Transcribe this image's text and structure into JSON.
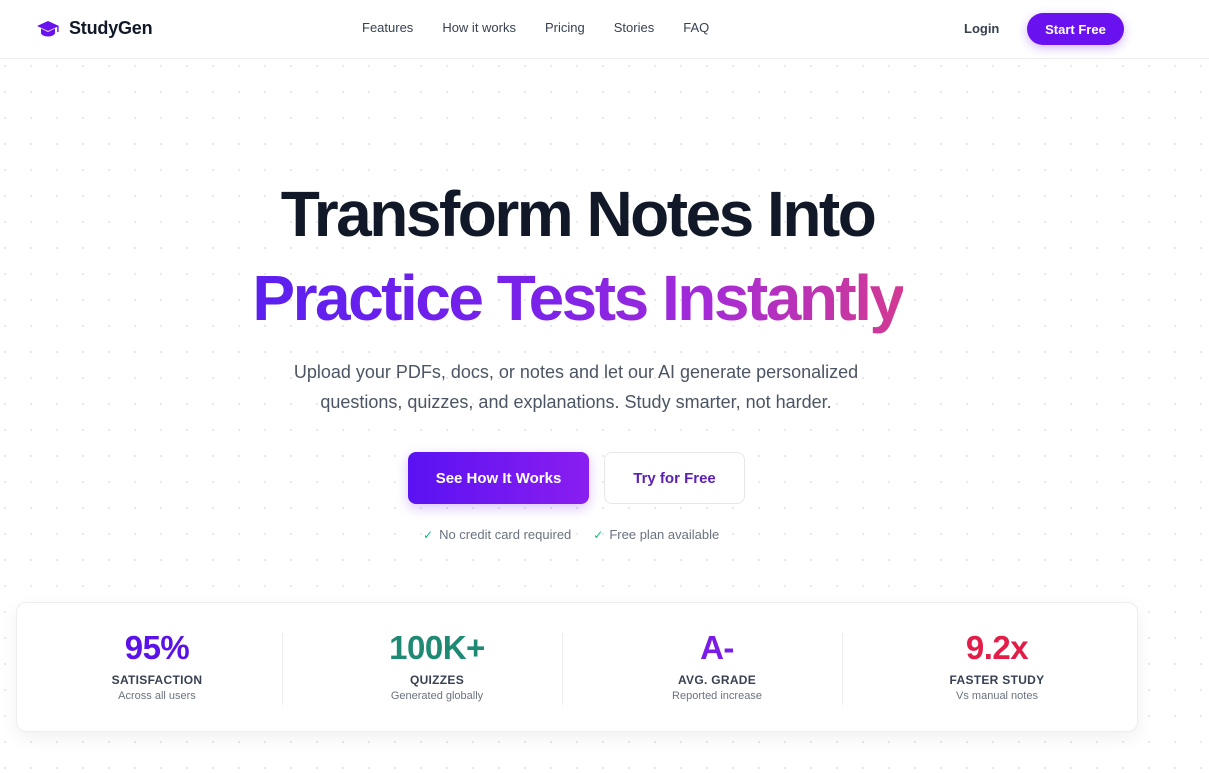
{
  "brand": {
    "name": "StudyGen"
  },
  "nav": {
    "links": [
      "Features",
      "How it works",
      "Pricing",
      "Stories",
      "FAQ"
    ],
    "login": "Login",
    "start_free": "Start Free"
  },
  "hero": {
    "title_line1": "Transform Notes Into",
    "title_line2": "Practice Tests Instantly",
    "subtitle_line1": "Upload your PDFs, docs, or notes and let our AI generate personalized",
    "subtitle_line2": "questions, quizzes, and explanations. Study smarter, not harder.",
    "primary_cta": "See How It Works",
    "secondary_cta": "Try for Free",
    "checks": [
      "No credit card required",
      "Free plan available"
    ]
  },
  "stats": [
    {
      "value": "95%",
      "label": "SATISFACTION",
      "desc": "Across all users",
      "color": "#5b12e8"
    },
    {
      "value": "100K+",
      "label": "QUIZZES",
      "desc": "Generated globally",
      "color": "#1f8a73"
    },
    {
      "value": "A-",
      "label": "AVG. GRADE",
      "desc": "Reported increase",
      "color": "#7a1ce8"
    },
    {
      "value": "9.2x",
      "label": "FASTER STUDY",
      "desc": "Vs manual notes",
      "color": "#e11d48"
    }
  ],
  "colors": {
    "accent": "#6a11f0",
    "text": "#111827",
    "muted": "#6b7280",
    "check": "#10b981"
  },
  "icons": {
    "brand": "graduation-cap-icon",
    "check": "check-icon"
  }
}
